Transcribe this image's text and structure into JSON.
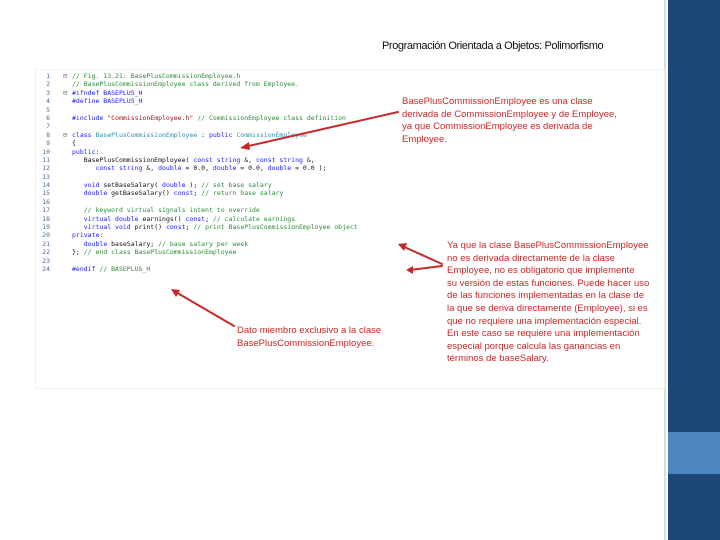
{
  "slide": {
    "title": "Programación Orientada a Objetos: Polimorfismo"
  },
  "code": {
    "line_numbers": [
      "1",
      "2",
      "3",
      "4",
      "5",
      "6",
      "7",
      "8",
      "9",
      "10",
      "11",
      "12",
      "13",
      "14",
      "15",
      "16",
      "17",
      "18",
      "19",
      "20",
      "21",
      "22",
      "23",
      "24"
    ],
    "gutter": [
      "⊟",
      "",
      "⊟",
      "",
      "",
      "",
      "",
      "⊟",
      "",
      "",
      "",
      "",
      "",
      "",
      "",
      "",
      "",
      "",
      "",
      "",
      "",
      "",
      "",
      ""
    ],
    "lines": [
      [
        {
          "t": "// Fig. 13.21: BasePlusCommissionEmployee.h",
          "c": "comment"
        }
      ],
      [
        {
          "t": "// BasePlusCommissionEmployee class derived from Employee.",
          "c": "comment"
        }
      ],
      [
        {
          "t": "#ifndef BASEPLUS_H",
          "c": "keyword"
        }
      ],
      [
        {
          "t": "#define BASEPLUS_H",
          "c": "keyword"
        }
      ],
      [
        {
          "t": "",
          "c": "text"
        }
      ],
      [
        {
          "t": "#include ",
          "c": "keyword"
        },
        {
          "t": "\"CommissionEmployee.h\"",
          "c": "string"
        },
        {
          "t": " // CommissionEmployee class definition",
          "c": "comment"
        }
      ],
      [
        {
          "t": "",
          "c": "text"
        }
      ],
      [
        {
          "t": "class ",
          "c": "keyword"
        },
        {
          "t": "BasePlusCommissionEmployee",
          "c": "type"
        },
        {
          "t": " : ",
          "c": "text"
        },
        {
          "t": "public ",
          "c": "keyword"
        },
        {
          "t": "CommissionEmployee",
          "c": "type"
        }
      ],
      [
        {
          "t": "{",
          "c": "text"
        }
      ],
      [
        {
          "t": "public",
          "c": "keyword"
        },
        {
          "t": ":",
          "c": "text"
        }
      ],
      [
        {
          "t": "   BasePlusCommissionEmployee( ",
          "c": "text"
        },
        {
          "t": "const string",
          "c": "keyword"
        },
        {
          "t": " &, ",
          "c": "text"
        },
        {
          "t": "const string",
          "c": "keyword"
        },
        {
          "t": " &,",
          "c": "text"
        }
      ],
      [
        {
          "t": "      ",
          "c": "text"
        },
        {
          "t": "const string",
          "c": "keyword"
        },
        {
          "t": " &, ",
          "c": "text"
        },
        {
          "t": "double",
          "c": "keyword"
        },
        {
          "t": " = 0.0, ",
          "c": "text"
        },
        {
          "t": "double",
          "c": "keyword"
        },
        {
          "t": " = 0.0, ",
          "c": "text"
        },
        {
          "t": "double",
          "c": "keyword"
        },
        {
          "t": " = 0.0 );",
          "c": "text"
        }
      ],
      [
        {
          "t": "",
          "c": "text"
        }
      ],
      [
        {
          "t": "   ",
          "c": "text"
        },
        {
          "t": "void",
          "c": "keyword"
        },
        {
          "t": " setBaseSalary( ",
          "c": "text"
        },
        {
          "t": "double",
          "c": "keyword"
        },
        {
          "t": " ); ",
          "c": "text"
        },
        {
          "t": "// set base salary",
          "c": "comment"
        }
      ],
      [
        {
          "t": "   ",
          "c": "text"
        },
        {
          "t": "double",
          "c": "keyword"
        },
        {
          "t": " getBaseSalary() ",
          "c": "text"
        },
        {
          "t": "const",
          "c": "keyword"
        },
        {
          "t": "; ",
          "c": "text"
        },
        {
          "t": "// return base salary",
          "c": "comment"
        }
      ],
      [
        {
          "t": "",
          "c": "text"
        }
      ],
      [
        {
          "t": "   // keyword virtual signals intent to override",
          "c": "comment"
        }
      ],
      [
        {
          "t": "   ",
          "c": "text"
        },
        {
          "t": "virtual double",
          "c": "keyword"
        },
        {
          "t": " earnings() ",
          "c": "text"
        },
        {
          "t": "const",
          "c": "keyword"
        },
        {
          "t": "; ",
          "c": "text"
        },
        {
          "t": "// calculate earnings",
          "c": "comment"
        }
      ],
      [
        {
          "t": "   ",
          "c": "text"
        },
        {
          "t": "virtual void",
          "c": "keyword"
        },
        {
          "t": " print() ",
          "c": "text"
        },
        {
          "t": "const",
          "c": "keyword"
        },
        {
          "t": "; ",
          "c": "text"
        },
        {
          "t": "// print BasePlusCommissionEmployee object",
          "c": "comment"
        }
      ],
      [
        {
          "t": "private",
          "c": "keyword"
        },
        {
          "t": ":",
          "c": "text"
        }
      ],
      [
        {
          "t": "   ",
          "c": "text"
        },
        {
          "t": "double",
          "c": "keyword"
        },
        {
          "t": " baseSalary; ",
          "c": "text"
        },
        {
          "t": "// base salary per week",
          "c": "comment"
        }
      ],
      [
        {
          "t": "}; ",
          "c": "text"
        },
        {
          "t": "// end class BasePlusCommissionEmployee",
          "c": "comment"
        }
      ],
      [
        {
          "t": "",
          "c": "text"
        }
      ],
      [
        {
          "t": "#endif ",
          "c": "keyword"
        },
        {
          "t": "// BASEPLUS_H",
          "c": "comment"
        }
      ]
    ]
  },
  "annotations": {
    "class_note": [
      "BasePlusCommissionEmployee es una clase",
      "derivada de CommissionEmployee y de Employee,",
      "ya que CommissionEmployee es derivada de",
      "Employee."
    ],
    "virtual_note": [
      "Ya que la clase BasePlusCommissionEmployee",
      "no es derivada directamente de la clase",
      "Employee, no es obligatorio que implemente",
      "su versión de estas funciones. Puede hacer uso",
      "de las funciones implementadas en la clase de",
      "la que se deriva directamente (Employee), si es",
      "que no requiere una implementación especial.",
      "En este caso se requiere una implementación",
      "especial porque calcula las ganancias en",
      "términos de baseSalary."
    ],
    "member_note": [
      "Dato miembro exclusivo a la clase",
      "BasePlusCommissionEmployee."
    ]
  },
  "colors": {
    "sidebar": "#1d4777",
    "sidebar_accent": "#4e86c2",
    "annotation": "#c62828",
    "arrow": "#c62828"
  }
}
